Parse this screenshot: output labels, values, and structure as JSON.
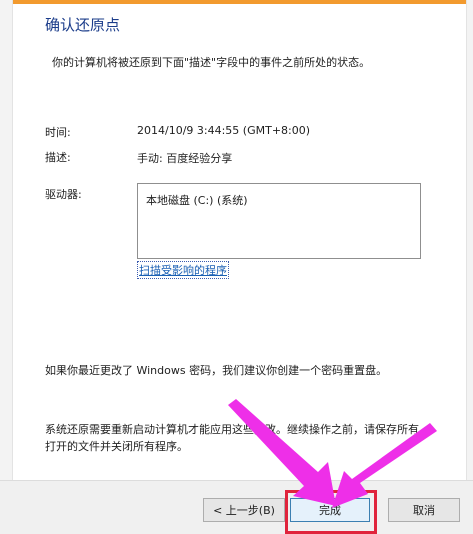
{
  "dialog": {
    "title": "确认还原点",
    "intro": "你的计算机将被还原到下面\"描述\"字段中的事件之前所处的状态。",
    "time_label": "时间:",
    "time_value": "2014/10/9 3:44:55 (GMT+8:00)",
    "desc_label": "描述:",
    "desc_value": "手动: 百度经验分享",
    "drives_label": "驱动器:",
    "drives": [
      "本地磁盘 (C:) (系统)"
    ],
    "scan_link": "扫描受影响的程序",
    "password_note": "如果你最近更改了 Windows 密码，我们建议你创建一个密码重置盘。",
    "restart_note_1": "系统还原需要重新启动计算机才能应用这些更改。继续操作之前，请保存所有",
    "restart_note_2": "打开的文件并关闭所有程序。"
  },
  "buttons": {
    "back": "< 上一步(B)",
    "finish": "完成",
    "cancel": "取消"
  },
  "colors": {
    "annotation_arrow": "#ee2fe8",
    "annotation_box": "#e0243c",
    "title": "#1b3c8a",
    "link": "#1a5fb4"
  }
}
